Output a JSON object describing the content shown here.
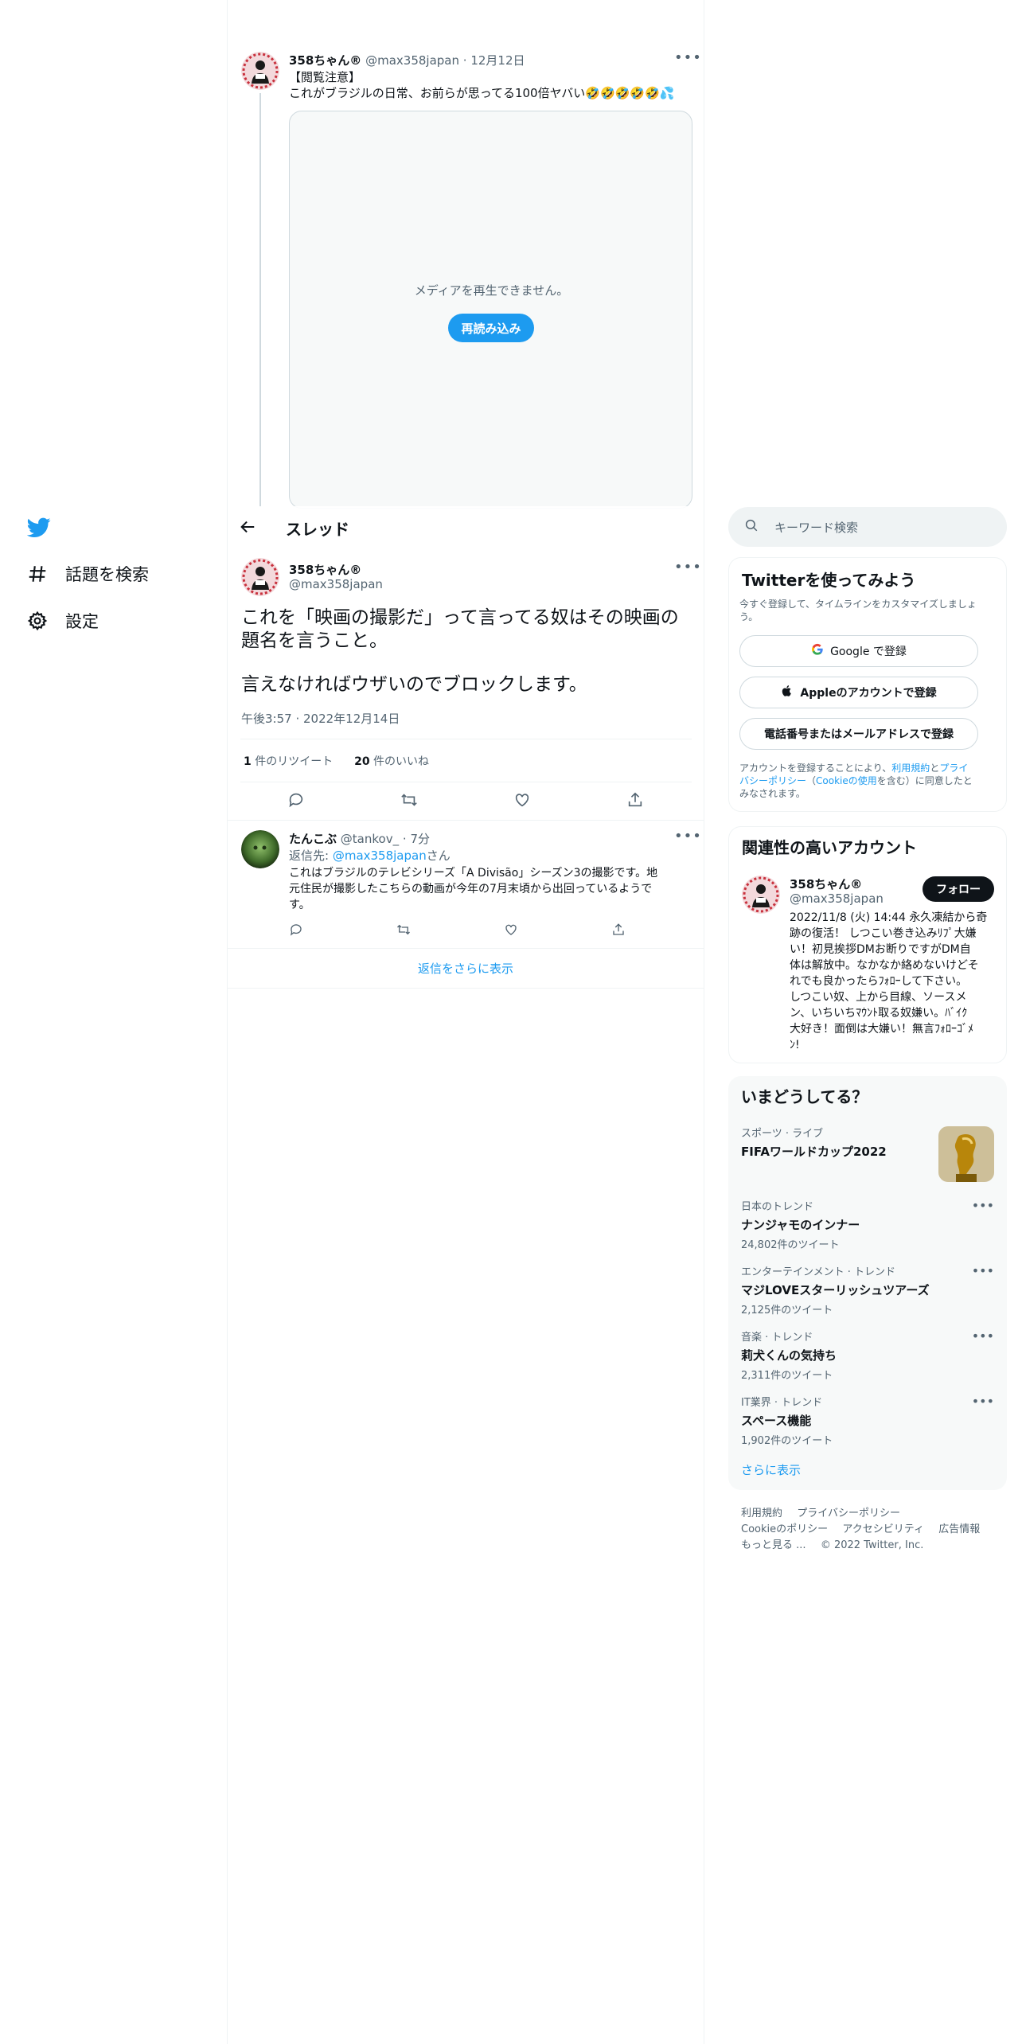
{
  "colors": {
    "accent": "#1d9bf0",
    "text": "#0f1419",
    "muted": "#536471",
    "border": "#eff3f4"
  },
  "nav": {
    "logo_icon": "twitter-bird-icon",
    "items": [
      {
        "icon": "hashtag-icon",
        "label": "話題を検索"
      },
      {
        "icon": "gear-icon",
        "label": "設定"
      }
    ]
  },
  "quoted_tweet": {
    "name": "358ちゃん®",
    "handle": "@max358japan",
    "sep": "·",
    "date": "12月12日",
    "line1": "【閲覧注意】",
    "line2": "これがブラジルの日常、お前らが思ってる100倍ヤバい🤣🤣🤣🤣🤣💦",
    "media_error": "メディアを再生できません。",
    "reload_label": "再読み込み"
  },
  "thread_header": {
    "back_icon": "back-arrow-icon",
    "title": "スレッド"
  },
  "main_tweet": {
    "name": "358ちゃん®",
    "handle": "@max358japan",
    "text_line1": "これを「映画の撮影だ」って言ってる奴はその映画の",
    "text_line2": "題名を言うこと。",
    "text_line3": "言えなければウザいのでブロックします。",
    "timestamp": "午後3:57 · 2022年12月14日",
    "retweet_count": "1",
    "retweet_label": "件のリツイート",
    "like_count": "20",
    "like_label": "件のいいね"
  },
  "reply": {
    "name": "たんこぶ",
    "handle": "@tankov_",
    "sep": "·",
    "time": "7分",
    "reply_to_prefix": "返信先: ",
    "reply_to_handle": "@max358japan",
    "reply_to_suffix": "さん",
    "text_line1": "これはブラジルのテレビシリーズ「A Divisão」シーズン3の撮影です。地",
    "text_line2": "元住民が撮影したこちらの動画が今年の7月末頃から出回っているようで",
    "text_line3": "す。"
  },
  "show_more_replies": "返信をさらに表示",
  "search": {
    "placeholder": "キーワード検索"
  },
  "signup": {
    "title": "Twitterを使ってみよう",
    "subtitle_line1": "今すぐ登録して、タイムラインをカスタマイズしましょ",
    "subtitle_line2": "う。",
    "google_label": "Google で登録",
    "apple_label": "Appleのアカウントで登録",
    "phone_label": "電話番号またはメールアドレスで登録",
    "legal_line1_prefix": "アカウントを登録することにより、",
    "legal_terms": "利用規約",
    "legal_and": "と",
    "legal_privacy_1": "プライ",
    "legal_privacy_2": "バシーポリシー",
    "legal_cookie_open": "（",
    "legal_cookie": "Cookieの使用",
    "legal_line2_suffix": "を含む）に同意したと",
    "legal_line3": "みなされます。"
  },
  "related": {
    "title": "関連性の高いアカウント",
    "name": "358ちゃん®",
    "handle": "@max358japan",
    "follow_label": "フォロー",
    "bio": [
      "2022/11/8 (火) 14:44 永久凍結から奇",
      "跡の復活！ しつこい巻き込みﾘﾌﾟ大嫌",
      "い！初見挨拶DMお断りですがDM自",
      "体は解放中。なかなか絡めないけどそ",
      "れでも良かったらﾌｫﾛｰして下さい。",
      "しつこい奴、上から目線、ソースメ",
      "ン、いちいちﾏｳﾝﾄ取る奴嫌い。ﾊﾞｲｸ",
      "大好き！面倒は大嫌い！無言ﾌｫﾛｰｺﾞﾒ",
      "ﾝ!"
    ]
  },
  "trends": {
    "title": "いまどうしてる？",
    "featured": {
      "category": "スポーツ · ライブ",
      "name": "FIFAワールドカップ2022"
    },
    "items": [
      {
        "category": "日本のトレンド",
        "name": "ナンジャモのインナー",
        "count": "24,802件のツイート"
      },
      {
        "category": "エンターテインメント · トレンド",
        "name": "マジLOVEスターリッシュツアーズ",
        "count": "2,125件のツイート"
      },
      {
        "category": "音楽 · トレンド",
        "name": "莉犬くんの気持ち",
        "count": "2,311件のツイート"
      },
      {
        "category": "IT業界 · トレンド",
        "name": "スペース機能",
        "count": "1,902件のツイート"
      }
    ],
    "show_more": "さらに表示"
  },
  "footer": {
    "terms": "利用規約",
    "privacy": "プライバシーポリシー",
    "cookie": "Cookieのポリシー",
    "accessibility": "アクセシビリティ",
    "ads": "広告情報",
    "more": "もっと見る ...",
    "copyright": "© 2022 Twitter, Inc."
  }
}
